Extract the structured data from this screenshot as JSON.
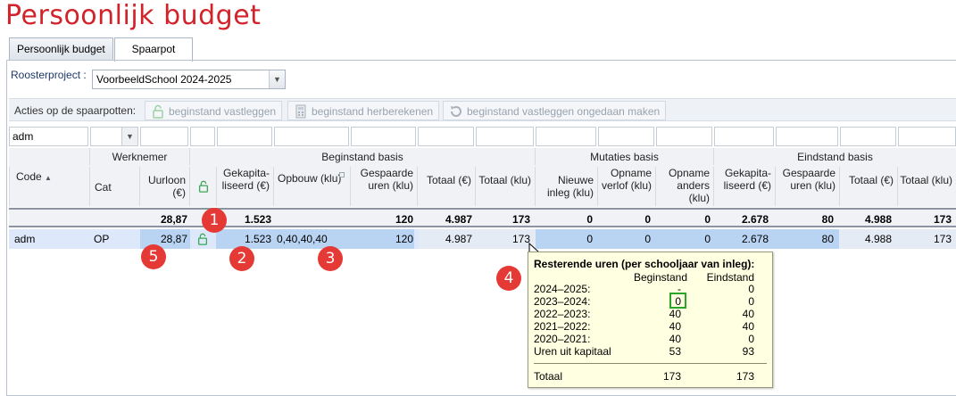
{
  "page": {
    "title": "Persoonlijk budget"
  },
  "tabs": [
    {
      "label": "Persoonlijk budget",
      "active": false
    },
    {
      "label": "Spaarpot",
      "active": true
    }
  ],
  "project": {
    "label": "Roosterproject :",
    "value": "VoorbeeldSchool 2024-2025"
  },
  "actions": {
    "label": "Acties op de spaarpotten:",
    "buttons": [
      "beginstand vastleggen",
      "beginstand herberekenen",
      "beginstand vastleggen ongedaan maken"
    ]
  },
  "filter": {
    "code_value": "adm"
  },
  "groups": {
    "werknemer": "Werknemer",
    "beginstand": "Beginstand basis",
    "mutaties": "Mutaties basis",
    "eindstand": "Eindstand basis"
  },
  "columns": {
    "code": "Code",
    "cat": "Cat",
    "uurloon": "Uurloon (€)",
    "gekap": "Gekapita-liseerd (€)",
    "opbouw": "Opbouw (klu)",
    "gespaard": "Gespaarde uren (klu)",
    "totaal_eur": "Totaal (€)",
    "totaal_klu": "Totaal (klu)",
    "nieuwe": "Nieuwe inleg (klu)",
    "verlof": "Opname verlof (klu)",
    "anders": "Opname anders (klu)",
    "e_gekap": "Gekapita-liseerd (€)",
    "e_gespaard": "Gespaarde uren (klu)",
    "e_totaal_eur": "Totaal (€)",
    "e_totaal_klu": "Totaal (klu)"
  },
  "summary": {
    "uurloon": "28,87",
    "gekap": "1.523",
    "gespaard": "120",
    "totaal_eur": "4.987",
    "totaal_klu": "173",
    "nieuwe": "0",
    "verlof": "0",
    "anders": "0",
    "e_gekap": "2.678",
    "e_gespaard": "80",
    "e_totaal_eur": "4.988",
    "e_totaal_klu": "173"
  },
  "row": {
    "code": "adm",
    "cat": "OP",
    "uurloon": "28,87",
    "gekap": "1.523",
    "opbouw": "0,40,40,40",
    "gespaard": "120",
    "totaal_eur": "4.987",
    "totaal_klu": "173",
    "nieuwe": "0",
    "verlof": "0",
    "anders": "0",
    "e_gekap": "2.678",
    "e_gespaard": "80",
    "e_totaal_eur": "4.988",
    "e_totaal_klu": "173"
  },
  "markers": [
    "1",
    "2",
    "3",
    "4",
    "5"
  ],
  "tooltip": {
    "title": "Resterende uren (per schooljaar van inleg):",
    "col1": "Beginstand",
    "col2": "Eindstand",
    "rows": [
      {
        "label": "2024–2025:",
        "begin": "-",
        "eind": "0"
      },
      {
        "label": "2023–2024:",
        "begin": "0",
        "eind": "0"
      },
      {
        "label": "2022–2023:",
        "begin": "40",
        "eind": "40"
      },
      {
        "label": "2021–2022:",
        "begin": "40",
        "eind": "40"
      },
      {
        "label": "2020–2021:",
        "begin": "40",
        "eind": "0"
      },
      {
        "label": "Uren uit kapitaal",
        "begin": "53",
        "eind": "93"
      }
    ],
    "total_label": "Totaal",
    "total_begin": "173",
    "total_eind": "173"
  },
  "colors": {
    "title": "#d2232a",
    "badge": "#e53935",
    "lock": "#3aa655",
    "highlight": "#2aa52a"
  }
}
